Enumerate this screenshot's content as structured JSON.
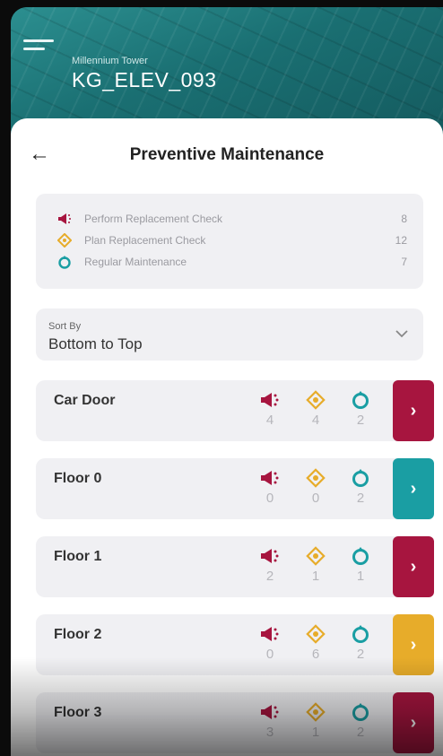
{
  "header": {
    "subtitle": "Millennium Tower",
    "title": "KG_ELEV_093"
  },
  "page": {
    "title": "Preventive Maintenance",
    "back_glyph": "←"
  },
  "legend": [
    {
      "icon": "megaphone-icon",
      "label": "Perform Replacement Check",
      "count": "8"
    },
    {
      "icon": "diamond-icon",
      "label": "Plan Replacement Check",
      "count": "12"
    },
    {
      "icon": "drop-icon",
      "label": "Regular Maintenance",
      "count": "7"
    }
  ],
  "sort": {
    "label": "Sort By",
    "value": "Bottom to Top"
  },
  "items": [
    {
      "name": "Car Door",
      "replace": "4",
      "plan": "4",
      "regular": "2",
      "action": "›",
      "color": "#a7153f"
    },
    {
      "name": "Floor 0",
      "replace": "0",
      "plan": "0",
      "regular": "2",
      "action": "›",
      "color": "#1a9ea3"
    },
    {
      "name": "Floor 1",
      "replace": "2",
      "plan": "1",
      "regular": "1",
      "action": "›",
      "color": "#a7153f"
    },
    {
      "name": "Floor 2",
      "replace": "0",
      "plan": "6",
      "regular": "2",
      "action": "›",
      "color": "#e7ac2a"
    },
    {
      "name": "Floor 3",
      "replace": "3",
      "plan": "1",
      "regular": "2",
      "action": "›",
      "color": "#a7153f"
    }
  ],
  "colors": {
    "replace": "#a7153f",
    "plan": "#e7ac2a",
    "regular": "#1a9ea3"
  }
}
